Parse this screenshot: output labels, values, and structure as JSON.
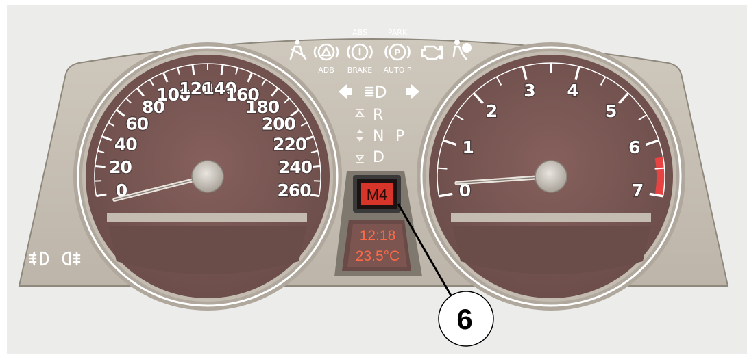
{
  "speedometer": {
    "ticks": [
      "0",
      "20",
      "40",
      "60",
      "80",
      "100",
      "120",
      "140",
      "160",
      "180",
      "200",
      "220",
      "240",
      "260"
    ],
    "needle_value": 0
  },
  "tachometer": {
    "ticks": [
      "0",
      "1",
      "2",
      "3",
      "4",
      "5",
      "6",
      "7"
    ],
    "needle_value": 0,
    "redline_from": 6.3
  },
  "warning_lights": {
    "abs_label": "ABS",
    "park_label": "PARK",
    "adb_label": "ADB",
    "brake_label": "BRAKE",
    "auto_p_label": "AUTO P",
    "icons": [
      "seatbelt-icon",
      "adb-warning-icon",
      "abs-brake-icon",
      "park-brake-icon",
      "check-engine-icon",
      "airbag-icon"
    ]
  },
  "gear_indicator": {
    "r": "R",
    "n": "N",
    "d": "D",
    "p": "P"
  },
  "gear_display": {
    "value": "M4"
  },
  "info_display": {
    "time": "12:18",
    "temperature": "23.5°C"
  },
  "callout": {
    "number": "6"
  },
  "colors": {
    "housing": "#c9c2b6",
    "dial_face": "#7a5a57",
    "redline": "#e84343",
    "display_text": "#ff5a3a"
  }
}
